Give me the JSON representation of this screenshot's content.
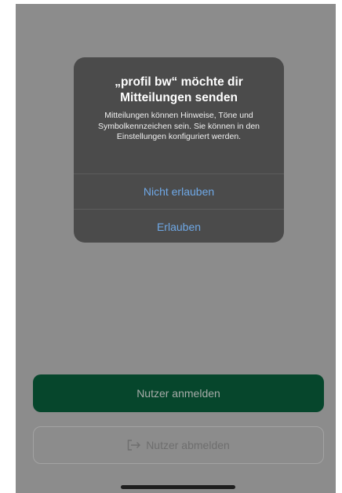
{
  "alert": {
    "title": "„profil bw“ möchte dir Mitteilungen senden",
    "message": "Mitteilungen können Hinweise, Töne und Symbolkennzeichen sein. Sie können in den Einstellungen konfiguriert werden.",
    "deny_label": "Nicht erlauben",
    "allow_label": "Erlauben"
  },
  "buttons": {
    "login_label": "Nutzer anmelden",
    "logout_label": "Nutzer abmelden",
    "logout_icon": "logout-arrow-icon"
  },
  "colors": {
    "overlay": "#8c8c8c",
    "alert_background": "#4b4b4b",
    "alert_button_text": "#6fa8e6",
    "primary_button": "#06462c"
  }
}
